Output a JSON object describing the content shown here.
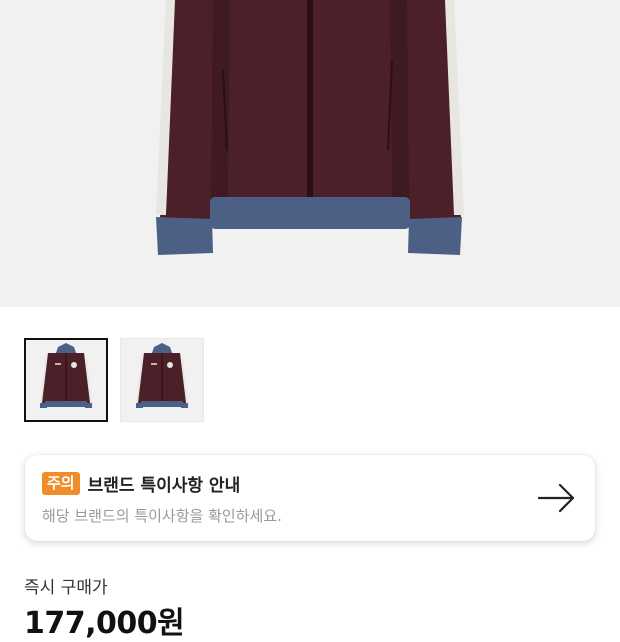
{
  "product": {
    "image_alt": "jacket-photo",
    "colors": {
      "body": "#4b2029",
      "rib": "#4c5f85",
      "stripe": "#e8e6e0",
      "background": "#f1f1f1"
    },
    "thumbnails": [
      {
        "name": "thumbnail-1",
        "selected": true
      },
      {
        "name": "thumbnail-2",
        "selected": false
      }
    ]
  },
  "notice": {
    "badge": "주의",
    "title": "브랜드 특이사항 안내",
    "description": "해당 브랜드의 특이사항을 확인하세요.",
    "accent_color": "#f08c2a"
  },
  "purchase": {
    "label": "즉시 구매가",
    "price": "177,000원"
  }
}
